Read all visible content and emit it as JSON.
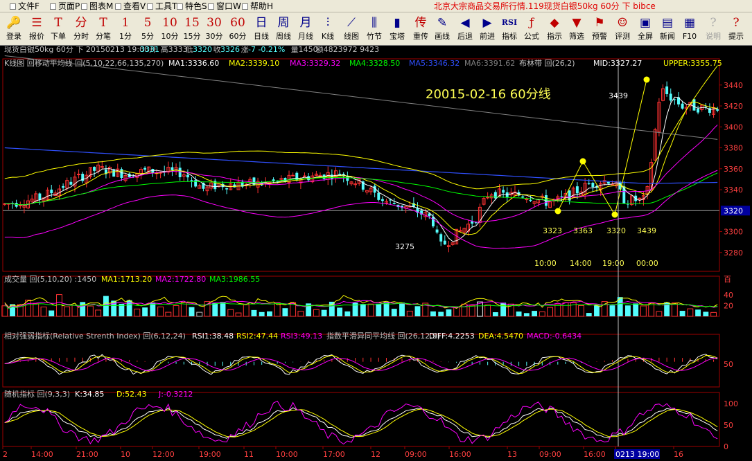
{
  "menu": [
    {
      "label": "文件F"
    },
    {
      "label": "页面P"
    },
    {
      "label": "图表M"
    },
    {
      "label": "查看V"
    },
    {
      "label": "工具T"
    },
    {
      "label": "特色S"
    },
    {
      "label": "窗口W"
    },
    {
      "label": "帮助H"
    }
  ],
  "window_title": "北京大宗商品交易所行情.119现货白银50kg 60分 下 bibce",
  "toolbar": [
    {
      "id": "login",
      "icon": "🔑",
      "label": "登录"
    },
    {
      "id": "quote",
      "icon": "☰",
      "label": "报价"
    },
    {
      "id": "order",
      "icon": "T",
      "label": "下单"
    },
    {
      "id": "ticks",
      "icon": "分",
      "label": "分时"
    },
    {
      "id": "trades",
      "icon": "T",
      "label": "分笔"
    },
    {
      "id": "m1",
      "icon": "1",
      "label": "1分"
    },
    {
      "id": "m5",
      "icon": "5",
      "label": "5分"
    },
    {
      "id": "m10",
      "icon": "10",
      "label": "10分"
    },
    {
      "id": "m15",
      "icon": "15",
      "label": "15分"
    },
    {
      "id": "m30",
      "icon": "30",
      "label": "30分"
    },
    {
      "id": "m60",
      "icon": "60",
      "label": "60分"
    },
    {
      "id": "day",
      "icon": "日",
      "label": "日线"
    },
    {
      "id": "week",
      "icon": "周",
      "label": "周线"
    },
    {
      "id": "month",
      "icon": "月",
      "label": "月线"
    },
    {
      "id": "kline",
      "icon": "⫶",
      "label": "K线"
    },
    {
      "id": "lines",
      "icon": "⟋",
      "label": "线图"
    },
    {
      "id": "bamboo",
      "icon": "⫼",
      "label": "竹节"
    },
    {
      "id": "tower",
      "icon": "▮",
      "label": "宝塔"
    },
    {
      "id": "overlay",
      "icon": "传",
      "label": "重传"
    },
    {
      "id": "draw",
      "icon": "✎",
      "label": "画线"
    },
    {
      "id": "back",
      "icon": "◀",
      "label": "后退"
    },
    {
      "id": "fwd",
      "icon": "▶",
      "label": "前进"
    },
    {
      "id": "indicator",
      "icon": "RSI",
      "label": "指标"
    },
    {
      "id": "formula",
      "icon": "ƒ",
      "label": "公式"
    },
    {
      "id": "hint",
      "icon": "◆",
      "label": "指示"
    },
    {
      "id": "filter",
      "icon": "▼",
      "label": "筛选"
    },
    {
      "id": "alert",
      "icon": "⚑",
      "label": "预警"
    },
    {
      "id": "eval",
      "icon": "☺",
      "label": "评测"
    },
    {
      "id": "fullscreen",
      "icon": "▣",
      "label": "全屏"
    },
    {
      "id": "news",
      "icon": "▤",
      "label": "新闻"
    },
    {
      "id": "f10",
      "icon": "▦",
      "label": "F10"
    },
    {
      "id": "help",
      "icon": "?",
      "label": "说明"
    },
    {
      "id": "tips",
      "icon": "?",
      "label": "提示"
    }
  ],
  "info_bar": {
    "prefix": "现货白银50kg 60分 下 20150213 19:00开",
    "open": "3331",
    "high_label": "高",
    "high": "3333",
    "low_label": "低",
    "low": "3320",
    "close_label": "收",
    "close": "3326",
    "chg_label": "涨",
    "chg": "-7",
    "pct": "-0.21%",
    "vol_label": "量1450",
    "amt_label": "额4823972",
    "amt_tail": "9423"
  },
  "kline_legend": {
    "ma_title": "K线图 回移动平均线 回(5,10,22,66,135,270)",
    "ma1": "MA1:3336.60",
    "ma2": "MA2:3339.10",
    "ma3": "MA3:3329.32",
    "ma4": "MA4:3328.50",
    "ma5": "MA5:3346.32",
    "ma6": "MA6:3391.62",
    "boll_title": "布林带 回(26,2)",
    "mid": "MID:3327.27",
    "upper": "UPPER:3355.75"
  },
  "annotation": {
    "title": "20015-02-16   60分线",
    "labels": [
      "3439",
      "3275",
      "3323",
      "3363",
      "3320",
      "3439"
    ],
    "times": [
      "10:00",
      "14:00",
      "19:00",
      "00:00"
    ]
  },
  "current_price": "3320",
  "price_axis": [
    "3440",
    "3420",
    "3400",
    "3380",
    "3360",
    "3340",
    "3300",
    "3280"
  ],
  "volume_legend": {
    "title": "成交量 回(5,10,20) :1450",
    "ma1": "MA1:1713.20",
    "ma2": "MA2:1722.80",
    "ma3": "MA3:1986.55"
  },
  "volume_axis": [
    "40",
    "20"
  ],
  "volume_axis_unit": "百",
  "rsi_legend": {
    "title": "相对强弱指标(Relative Strenth Index) 回(6,12,24)",
    "rsi1": "RSI1:38.48",
    "rsi2": "RSI2:47.44",
    "rsi3": "RSI3:49.13",
    "macd_title": "指数平滑异同平均线 回(26,12,9)",
    "diff": "DIFF:4.2253",
    "dea": "DEA:4.5470",
    "macd": "MACD:-0.6434"
  },
  "rsi_axis": [
    "50"
  ],
  "kdj_legend": {
    "title": "随机指标 回(9,3,3)",
    "k": "K:34.85",
    "d": "D:52.43",
    "j": "J:-0.3212"
  },
  "kdj_axis": [
    "100",
    "50",
    "0"
  ],
  "time_axis": [
    "2",
    "14:00",
    "21:00",
    "10",
    "12:00",
    "19:00",
    "11",
    "10:00",
    "17:00",
    "12",
    "09:00",
    "16:00",
    "13",
    "09:00",
    "16:00",
    "0213 19:00",
    "16"
  ],
  "colors": {
    "up": "#ff3232",
    "down": "#54fcfc",
    "ma1": "#ffffff",
    "ma2": "#ffff00",
    "ma3": "#ff00ff",
    "ma4": "#00ff00",
    "ma5": "#3050ff",
    "ma6": "#808080",
    "title": "#ffff54"
  }
}
